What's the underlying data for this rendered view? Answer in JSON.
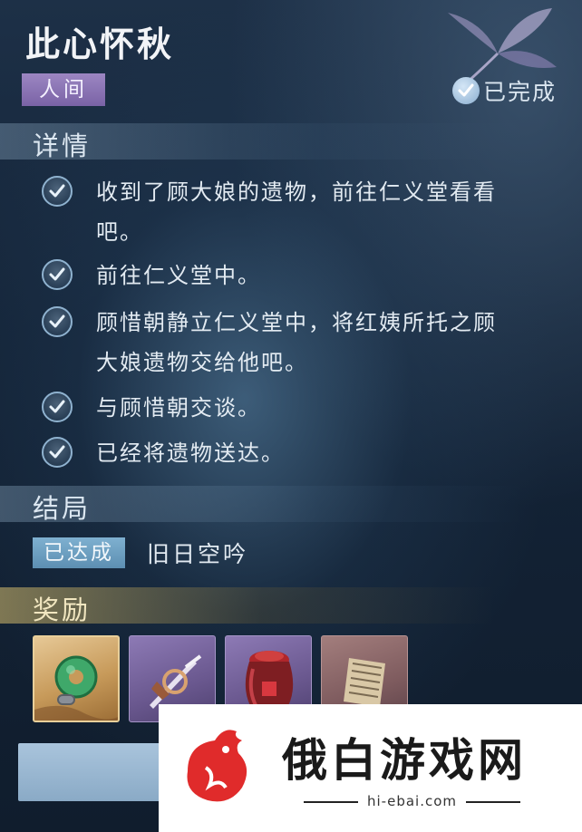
{
  "quest": {
    "title": "此心怀秋",
    "category": "人间",
    "status": "已完成"
  },
  "details": {
    "heading": "详情",
    "tasks": [
      {
        "text_line1": "收到了顾大娘的遗物，前往仁义堂看看",
        "text_line2": "吧。",
        "completed": true
      },
      {
        "text_line1": "前往仁义堂中。",
        "text_line2": "",
        "completed": true
      },
      {
        "text_line1": "顾惜朝静立仁义堂中，将红姨所托之顾",
        "text_line2": "大娘遗物交给他吧。",
        "completed": true
      },
      {
        "text_line1": "与顾惜朝交谈。",
        "text_line2": "",
        "completed": true
      },
      {
        "text_line1": "已经将遗物送达。",
        "text_line2": "",
        "completed": true
      }
    ]
  },
  "ending": {
    "heading": "结局",
    "badge": "已达成",
    "name": "旧日空吟"
  },
  "rewards": {
    "heading": "奖励",
    "items": [
      {
        "icon": "jade-pendant-icon",
        "rarity": "gold"
      },
      {
        "icon": "dagger-icon",
        "rarity": "purple"
      },
      {
        "icon": "wine-jar-icon",
        "rarity": "purple"
      },
      {
        "icon": "scroll-book-icon",
        "rarity": "rose"
      }
    ]
  },
  "watermark": {
    "name": "俄白游戏网",
    "url": "hi-ebai.com"
  },
  "colors": {
    "accent_purple": "#8c76b6",
    "accent_blue": "#6f9fc2",
    "reward_gold": "#d9b87c"
  }
}
